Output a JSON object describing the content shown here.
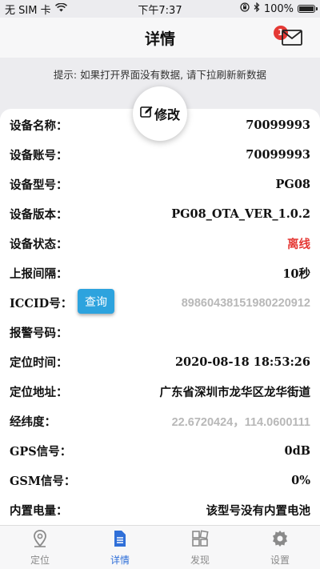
{
  "status_bar": {
    "carrier": "无 SIM 卡",
    "time": "下午7:37",
    "battery_text": "100%",
    "battery_level": 1.0
  },
  "nav": {
    "title": "详情",
    "mail_badge": "1"
  },
  "hint": "提示: 如果打开界面没有数据, 请下拉刷新新数据",
  "edit_button": "修改",
  "query_button": "查询",
  "rows": [
    {
      "label": "设备名称：",
      "value": "70099993"
    },
    {
      "label": "设备账号：",
      "value": "70099993"
    },
    {
      "label": "设备型号：",
      "value": "PG08"
    },
    {
      "label": "设备版本：",
      "value": "PG08_OTA_VER_1.0.2"
    },
    {
      "label": "设备状态：",
      "value": "离线"
    },
    {
      "label": "上报间隔：",
      "value": "10秒"
    },
    {
      "label": "ICCID号：",
      "value": "8986043815198022091​2"
    },
    {
      "label": "报警号码：",
      "value": ""
    },
    {
      "label": "定位时间：",
      "value": "2020-08-18 18:53:26"
    },
    {
      "label": "定位地址：",
      "value": "广东省深圳市龙华区龙华街道"
    },
    {
      "label": "经纬度：",
      "value": "22.6720424，114.0600111"
    },
    {
      "label": "GPS信号：",
      "value": "0dB"
    },
    {
      "label": "GSM信号：",
      "value": "0%"
    },
    {
      "label": "内置电量：",
      "value": "该型号没有内置电池"
    }
  ],
  "tabs": [
    {
      "label": "定位",
      "icon": "location-pin-icon"
    },
    {
      "label": "详情",
      "icon": "document-icon"
    },
    {
      "label": "发现",
      "icon": "grid-icon"
    },
    {
      "label": "设置",
      "icon": "gear-icon"
    }
  ],
  "colors": {
    "accent": "#2f6fd8",
    "offline": "#e53935",
    "query_button": "#2da3de"
  }
}
